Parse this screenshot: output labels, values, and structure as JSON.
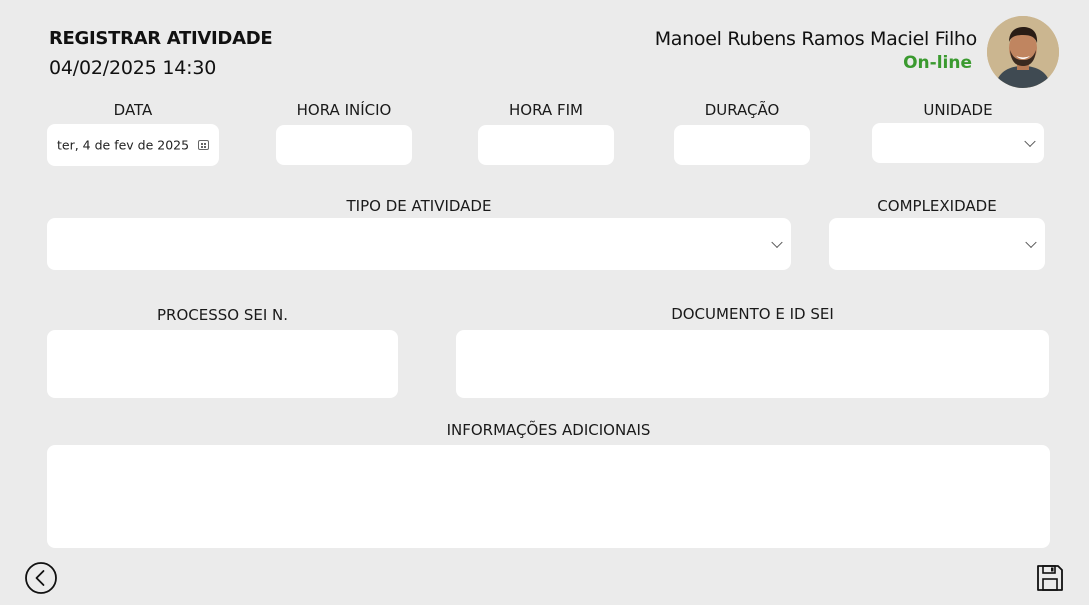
{
  "header": {
    "title": "REGISTRAR ATIVIDADE",
    "datetime": "04/02/2025 14:30",
    "user_name": "Manoel Rubens Ramos Maciel Filho",
    "status": "On-line",
    "status_color": "#3a9a2f"
  },
  "form": {
    "data": {
      "label": "DATA",
      "value": "ter, 4 de fev de 2025"
    },
    "hora_inicio": {
      "label": "HORA INÍCIO",
      "value": ""
    },
    "hora_fim": {
      "label": "HORA FIM",
      "value": ""
    },
    "duracao": {
      "label": "DURAÇÃO",
      "value": ""
    },
    "unidade": {
      "label": "UNIDADE",
      "value": ""
    },
    "tipo_atividade": {
      "label": "TIPO DE ATIVIDADE",
      "value": ""
    },
    "complexidade": {
      "label": "COMPLEXIDADE",
      "value": ""
    },
    "processo_sei": {
      "label": "PROCESSO SEI N.",
      "value": ""
    },
    "documento_id_sei": {
      "label": "DOCUMENTO E ID SEI",
      "value": ""
    },
    "informacoes": {
      "label": "INFORMAÇÕES ADICIONAIS",
      "value": ""
    }
  },
  "icons": {
    "back": "chevron-left-circle-icon",
    "save": "floppy-disk-icon",
    "calendar": "calendar-icon",
    "dropdown": "chevron-down-icon"
  }
}
